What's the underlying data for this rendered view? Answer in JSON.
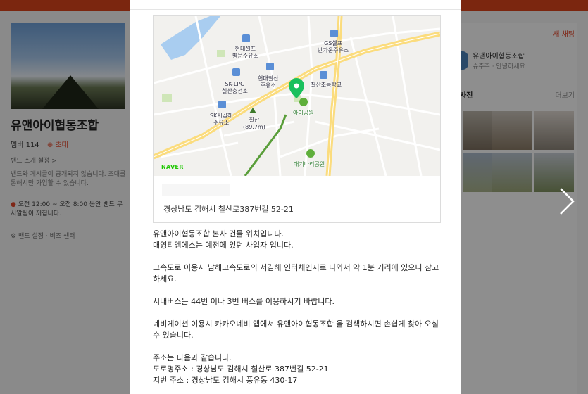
{
  "band": {
    "name": "유앤아이협동조합",
    "member_label": "멤버 114",
    "invite_label": "초대",
    "intro_setting": "밴드 소개 설정 >",
    "description": "밴드와 게시글이 공개되지 않습니다. 초대를 통해서만 가입할 수 있습니다.",
    "notice": "오전 12:00 ~ 오전 8:00 동안 밴드 무시알림이 꺼집니다.",
    "settings_label": "밴드 설정 · 비즈 센터"
  },
  "right_panel": {
    "new_chat_label": "새 채팅",
    "chat": {
      "name": "유앤아이협동조합",
      "message": "슈주주 · 안녕하세요"
    },
    "photos_title": "사진",
    "more_label": "더보기"
  },
  "map": {
    "labels": {
      "hyundai_self": "현대셀프\n명문주유소",
      "gs_self": "GS셀프\n반가운주유소",
      "hyundai_chilsan": "현대칠산\n주유소",
      "sk_lpg": "SK-LPG\n칠산충전소",
      "chilsan_school": "칠산초등학교",
      "ai_park": "아이공원",
      "sk_gimhae": "SK서김해\n주유소",
      "chilsan_mountain": "칠산\n(89.7m)",
      "aegi_park": "애기나리공원"
    },
    "provider": "NAVER"
  },
  "place": {
    "address": "경상남도 김해시 칠산로387번길 52-21"
  },
  "post": {
    "paragraphs": [
      [
        "유앤아이협동조합 본사 건물 위치입니다.",
        "대영티엠에스는 예전에 있던 사업자 입니다."
      ],
      [
        "고속도로 이용시 남해고속도로의 서김해 인터체인지로 나와서 약 1분 거리에 있으니 참고하세요."
      ],
      [
        "시내버스는 44번 이나 3번 버스를 이용하시기 바랍니다."
      ],
      [
        "네비게이션 이용시 카카오네비 앱에서 유앤아이협동조합 을 검색하시면 손쉽게 찾아 오실수 있습니다."
      ],
      [
        "주소는 다음과 같습니다.",
        "도로명주소 : 경상남도 김해시 칠산로 387번길 52-21",
        "지번 주소 :  경상남도 김해시 풍유동 430-17"
      ]
    ]
  },
  "colors": {
    "brand": "#d9441c",
    "map_pin": "#19c05d",
    "road_major": "#fbe08a",
    "trail": "#5a9e3a"
  }
}
